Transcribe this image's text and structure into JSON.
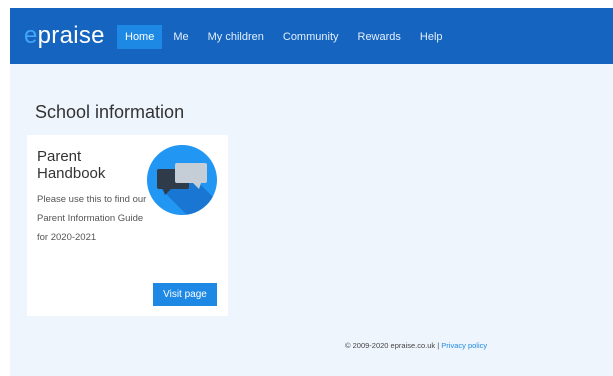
{
  "brand": {
    "logo_first": "e",
    "logo_rest": "praise"
  },
  "nav": {
    "items": [
      {
        "label": "Home",
        "active": true
      },
      {
        "label": "Me"
      },
      {
        "label": "My children"
      },
      {
        "label": "Community"
      },
      {
        "label": "Rewards"
      },
      {
        "label": "Help"
      }
    ]
  },
  "main": {
    "page_title": "School information",
    "card": {
      "title": "Parent Handbook",
      "description": "Please use this to find our Parent Information Guide for 2020-2021",
      "icon": "speech-bubbles-icon",
      "button_label": "Visit page"
    }
  },
  "footer": {
    "copyright": "© 2009-2020 epraise.co.uk",
    "separator": " | ",
    "privacy_label": "Privacy policy"
  },
  "colors": {
    "navbar": "#1565c0",
    "accent": "#1e88e5",
    "page_bg": "#eef5fc"
  }
}
